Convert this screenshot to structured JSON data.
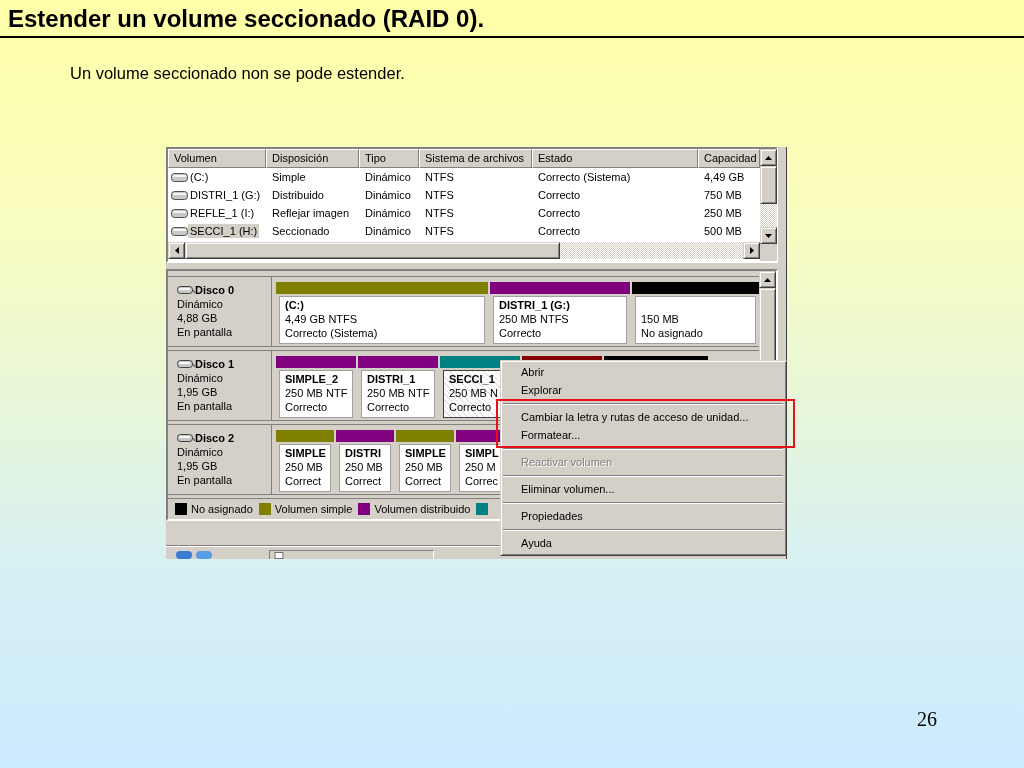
{
  "slide": {
    "title": "Estender un volume seccionado (RAID 0).",
    "subtitle": "Un volume seccionado non se pode estender.",
    "page_number": "26"
  },
  "volume_list": {
    "columns": [
      "Volumen",
      "Disposición",
      "Tipo",
      "Sistema de archivos",
      "Estado",
      "Capacidad"
    ],
    "rows": [
      {
        "cells": [
          "(C:)",
          "Simple",
          "Dinámico",
          "NTFS",
          "Correcto (Sistema)",
          "4,49 GB"
        ],
        "selected": false
      },
      {
        "cells": [
          "DISTRI_1 (G:)",
          "Distribuido",
          "Dinámico",
          "NTFS",
          "Correcto",
          "750 MB"
        ],
        "selected": false
      },
      {
        "cells": [
          "REFLE_1 (I:)",
          "Reflejar imagen",
          "Dinámico",
          "NTFS",
          "Correcto",
          "250 MB"
        ],
        "selected": false
      },
      {
        "cells": [
          "SECCI_1 (H:)",
          "Seccionado",
          "Dinámico",
          "NTFS",
          "Correcto",
          "500 MB"
        ],
        "selected": true
      }
    ]
  },
  "disks": [
    {
      "name": "Disco 0",
      "type": "Dinámico",
      "size": "4,88 GB",
      "status": "En pantalla",
      "partitions": [
        {
          "label": "(C:)",
          "size": "4,49 GB NTFS",
          "status": "Correcto (Sistema)",
          "color": "#808000",
          "selected": false
        },
        {
          "label": "DISTRI_1 (G:)",
          "size": "250 MB NTFS",
          "status": "Correcto",
          "color": "#800080",
          "selected": false
        },
        {
          "size": "150 MB",
          "status": "No asignado",
          "color": "#000000",
          "selected": false
        }
      ]
    },
    {
      "name": "Disco 1",
      "type": "Dinámico",
      "size": "1,95 GB",
      "status": "En pantalla",
      "partitions": [
        {
          "label": "SIMPLE_2",
          "size": "250 MB NTF",
          "status": "Correcto",
          "color": "#800080",
          "selected": false
        },
        {
          "label": "DISTRI_1",
          "size": "250 MB NTF",
          "status": "Correcto",
          "color": "#800080",
          "selected": false
        },
        {
          "label": "SECCI_1",
          "size": "250 MB N",
          "status": "Correcto",
          "color": "#008080",
          "selected": true
        },
        {
          "color": "#800000"
        },
        {
          "color": "#000000"
        }
      ]
    },
    {
      "name": "Disco 2",
      "type": "Dinámico",
      "size": "1,95 GB",
      "status": "En pantalla",
      "partitions": [
        {
          "label": "SIMPLE",
          "size": "250 MB",
          "status": "Correct",
          "color": "#808000",
          "selected": false
        },
        {
          "label": "DISTRI",
          "size": "250 MB",
          "status": "Correct",
          "color": "#800080",
          "selected": false
        },
        {
          "label": "SIMPLE",
          "size": "250 MB",
          "status": "Correct",
          "color": "#808000",
          "selected": false
        },
        {
          "label": "SIMPL",
          "size": "250 M",
          "status": "Correc",
          "color": "#800080",
          "selected": false
        }
      ]
    }
  ],
  "legend": [
    {
      "label": "No asignado",
      "color": "#000000"
    },
    {
      "label": "Volumen simple",
      "color": "#808000"
    },
    {
      "label": "Volumen distribuido",
      "color": "#800080"
    },
    {
      "color": "#008080"
    }
  ],
  "context_menu": {
    "groups": [
      {
        "highlighted": false,
        "items": [
          {
            "label": "Abrir",
            "disabled": false
          },
          {
            "label": "Explorar",
            "disabled": false
          }
        ]
      },
      {
        "highlighted": true,
        "items": [
          {
            "label": "Cambiar la letra y rutas de acceso de unidad...",
            "disabled": false
          },
          {
            "label": "Formatear...",
            "disabled": false
          }
        ]
      },
      {
        "highlighted": false,
        "items": [
          {
            "label": "Reactivar volumen",
            "disabled": true
          }
        ]
      },
      {
        "highlighted": false,
        "items": [
          {
            "label": "Eliminar volumen...",
            "disabled": false
          }
        ]
      },
      {
        "highlighted": false,
        "items": [
          {
            "label": "Propiedades",
            "disabled": false
          }
        ]
      },
      {
        "highlighted": false,
        "items": [
          {
            "label": "Ayuda",
            "disabled": false
          }
        ]
      }
    ]
  }
}
